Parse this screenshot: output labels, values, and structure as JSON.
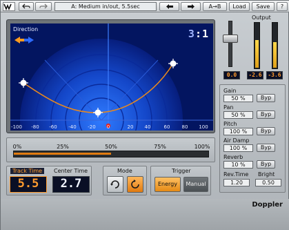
{
  "toolbar": {
    "preset_name": "A: Medium in/out, 5.5sec",
    "ab_label": "A→B",
    "load_label": "Load",
    "save_label": "Save",
    "help_label": "?"
  },
  "display": {
    "title": "Direction",
    "counter_prefix": "3",
    "counter_hi": "1",
    "x_ticks": [
      "-100",
      "-80",
      "-60",
      "-40",
      "-20",
      "0",
      "20",
      "40",
      "60",
      "80",
      "100"
    ]
  },
  "progress": {
    "labels": [
      "0%",
      "25%",
      "50%",
      "75%",
      "100%"
    ],
    "position_fraction": 0.5
  },
  "track_time": {
    "label": "Track Time",
    "value": "5.5"
  },
  "center_time": {
    "label": "Center Time",
    "value": "2.7"
  },
  "mode": {
    "label": "Mode"
  },
  "trigger": {
    "label": "Trigger",
    "energy_label": "Energy",
    "manual_label": "Manual"
  },
  "output": {
    "label": "Output",
    "master_value": "0.0",
    "left_value": "-2.6",
    "right_value": "-3.6",
    "left_level": 0.62,
    "right_level": 0.58
  },
  "params": {
    "gain": {
      "label": "Gain",
      "value": "50 %",
      "byp": "Byp"
    },
    "pan": {
      "label": "Pan",
      "value": "50 %",
      "byp": "Byp"
    },
    "pitch": {
      "label": "Pitch",
      "value": "100 %",
      "byp": "Byp"
    },
    "air_damp": {
      "label": "Air Damp",
      "value": "100 %",
      "byp": "Byp"
    },
    "reverb": {
      "label": "Reverb",
      "value": "10 %",
      "byp": "Byp"
    },
    "rev_time": {
      "label": "Rev.Time",
      "value": "1.20"
    },
    "bright": {
      "label": "Bright",
      "value": "0.50"
    }
  },
  "brand": {
    "name": "Doppler"
  },
  "colors": {
    "display_bg": "#031560",
    "accent_orange": "#e07a10",
    "lcd_orange": "#ff9b2e",
    "lcd_white": "#f0f4ff"
  }
}
